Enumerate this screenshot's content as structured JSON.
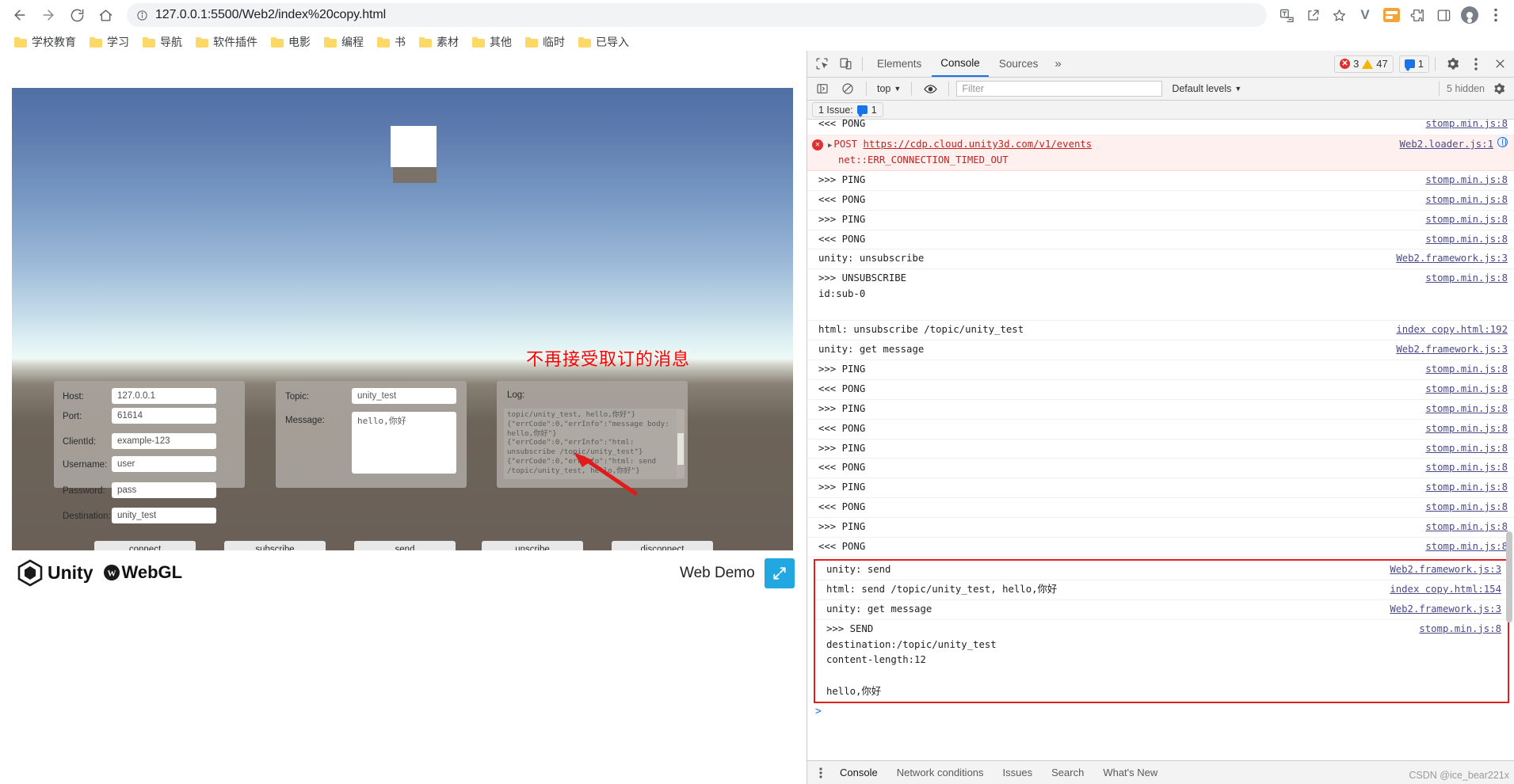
{
  "browser": {
    "url": "127.0.0.1:5500/Web2/index%20copy.html",
    "back_label": "Back",
    "forward_label": "Forward",
    "reload_label": "Reload",
    "home_label": "Home",
    "bookmarks": [
      {
        "label": "学校教育"
      },
      {
        "label": "学习"
      },
      {
        "label": "导航"
      },
      {
        "label": "软件插件"
      },
      {
        "label": "电影"
      },
      {
        "label": "编程"
      },
      {
        "label": "书"
      },
      {
        "label": "素材"
      },
      {
        "label": "其他"
      },
      {
        "label": "临时"
      },
      {
        "label": "已导入"
      }
    ]
  },
  "unity": {
    "warning_text": "不再接受取订的消息",
    "connection_panel": {
      "fields": [
        {
          "label": "Host:",
          "value": "127.0.0.1"
        },
        {
          "label": "Port:",
          "value": "61614"
        },
        {
          "label": "ClientId:",
          "value": "example-123"
        },
        {
          "label": "Username:",
          "value": "user"
        },
        {
          "label": "Password:",
          "value": "pass"
        },
        {
          "label": "Destination:",
          "value": "unity_test"
        }
      ]
    },
    "message_panel": {
      "topic_label": "Topic:",
      "topic_value": "unity_test",
      "message_label": "Message:",
      "message_value": "hello,你好"
    },
    "log_panel": {
      "title": "Log:",
      "content": "topic/unity_test, hello,你好\"}\n{\"errCode\":0,\"errInfo\":\"message body:\nhello,你好\"}\n{\"errCode\":0,\"errInfo\":\"html:\nunsubscribe /topic/unity_test\"}\n{\"errCode\":0,\"errInfo\":\"html: send\n/topic/unity_test, hello,你好\"}"
    },
    "buttons": [
      {
        "label": "connect"
      },
      {
        "label": "subscribe"
      },
      {
        "label": "send"
      },
      {
        "label": "unscribe"
      },
      {
        "label": "disconnect"
      }
    ],
    "footer": {
      "unity_label": "Unity",
      "webgl_label": "WebGL",
      "demo_label": "Web Demo",
      "fullscreen_label": "Fullscreen"
    }
  },
  "devtools": {
    "tabs": [
      {
        "label": "Elements",
        "active": false
      },
      {
        "label": "Console",
        "active": true
      },
      {
        "label": "Sources",
        "active": false
      }
    ],
    "more_tabs_label": "»",
    "errors_count": "3",
    "warnings_count": "47",
    "messages_count": "1",
    "settings_label": "Settings",
    "close_label": "Close",
    "filter": {
      "context": "top",
      "placeholder": "Filter",
      "value": "",
      "levels": "Default levels",
      "hidden": "5 hidden"
    },
    "issue_bar": {
      "label": "1 Issue:",
      "count": "1"
    },
    "console_rows": [
      {
        "msg": "<<< PONG",
        "src": "stomp.min.js:8",
        "type": "normal",
        "clipped": true
      },
      {
        "msg": "POST https://cdp.cloud.unity3d.com/v1/events\nnet::ERR_CONNECTION_TIMED_OUT",
        "src": "Web2.loader.js:1",
        "type": "error"
      },
      {
        "msg": ">>> PING",
        "src": "stomp.min.js:8",
        "type": "normal"
      },
      {
        "msg": "<<< PONG",
        "src": "stomp.min.js:8",
        "type": "normal"
      },
      {
        "msg": ">>> PING",
        "src": "stomp.min.js:8",
        "type": "normal"
      },
      {
        "msg": "<<< PONG",
        "src": "stomp.min.js:8",
        "type": "normal"
      },
      {
        "msg": "unity: unsubscribe",
        "src": "Web2.framework.js:3",
        "type": "normal"
      },
      {
        "msg": ">>> UNSUBSCRIBE\nid:sub-0\n\n",
        "src": "stomp.min.js:8",
        "type": "normal"
      },
      {
        "msg": "html: unsubscribe /topic/unity_test",
        "src": "index copy.html:192",
        "type": "normal"
      },
      {
        "msg": "unity: get message",
        "src": "Web2.framework.js:3",
        "type": "normal"
      },
      {
        "msg": ">>> PING",
        "src": "stomp.min.js:8",
        "type": "normal"
      },
      {
        "msg": "<<< PONG",
        "src": "stomp.min.js:8",
        "type": "normal"
      },
      {
        "msg": ">>> PING",
        "src": "stomp.min.js:8",
        "type": "normal"
      },
      {
        "msg": "<<< PONG",
        "src": "stomp.min.js:8",
        "type": "normal"
      },
      {
        "msg": ">>> PING",
        "src": "stomp.min.js:8",
        "type": "normal"
      },
      {
        "msg": "<<< PONG",
        "src": "stomp.min.js:8",
        "type": "normal"
      },
      {
        "msg": ">>> PING",
        "src": "stomp.min.js:8",
        "type": "normal"
      },
      {
        "msg": "<<< PONG",
        "src": "stomp.min.js:8",
        "type": "normal"
      },
      {
        "msg": ">>> PING",
        "src": "stomp.min.js:8",
        "type": "normal"
      },
      {
        "msg": "<<< PONG",
        "src": "stomp.min.js:8",
        "type": "normal"
      }
    ],
    "highlighted_rows": [
      {
        "msg": "unity: send",
        "src": "Web2.framework.js:3"
      },
      {
        "msg": "html: send /topic/unity_test, hello,你好",
        "src": "index copy.html:154"
      },
      {
        "msg": "unity: get message",
        "src": "Web2.framework.js:3"
      },
      {
        "msg": ">>> SEND\ndestination:/topic/unity_test\ncontent-length:12\n\nhello,你好",
        "src": "stomp.min.js:8"
      }
    ],
    "prompt_symbol": ">",
    "drawer_tabs": [
      {
        "label": "Console",
        "active": true
      },
      {
        "label": "Network conditions",
        "active": false
      },
      {
        "label": "Issues",
        "active": false
      },
      {
        "label": "Search",
        "active": false
      },
      {
        "label": "What's New",
        "active": false
      }
    ]
  },
  "watermark": "CSDN @ice_bear221x"
}
